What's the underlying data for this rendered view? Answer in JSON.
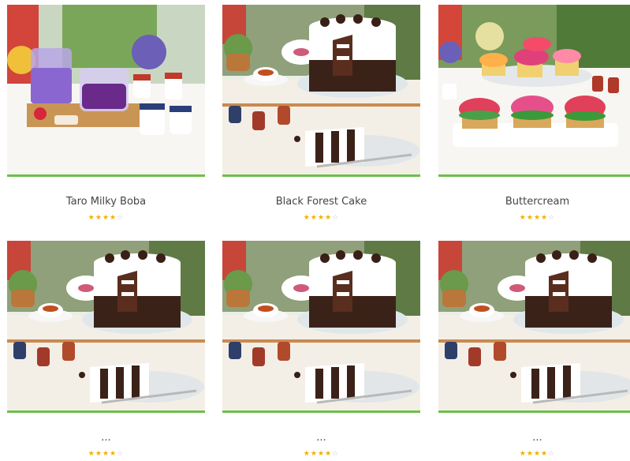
{
  "products": [
    {
      "title": "Taro Milky Boba",
      "rating": 4,
      "max_rating": 5,
      "image": "taro-boba-photo"
    },
    {
      "title": "Black Forest Cake",
      "rating": 4,
      "max_rating": 5,
      "image": "black-forest-cake-photo"
    },
    {
      "title": "Buttercream",
      "rating": 4,
      "max_rating": 5,
      "image": "buttercream-cupcakes-photo"
    },
    {
      "title": "...",
      "rating": 4,
      "max_rating": 5,
      "image": "black-forest-cake-photo"
    },
    {
      "title": "...",
      "rating": 4,
      "max_rating": 5,
      "image": "black-forest-cake-photo"
    },
    {
      "title": "...",
      "rating": 4,
      "max_rating": 5,
      "image": "black-forest-cake-photo"
    }
  ],
  "colors": {
    "accent_border": "#6cc04a",
    "star_filled": "#f0b000",
    "star_empty": "#c9c9c9"
  },
  "icons": {
    "star_filled": "star-filled-icon",
    "star_empty": "star-empty-icon"
  }
}
